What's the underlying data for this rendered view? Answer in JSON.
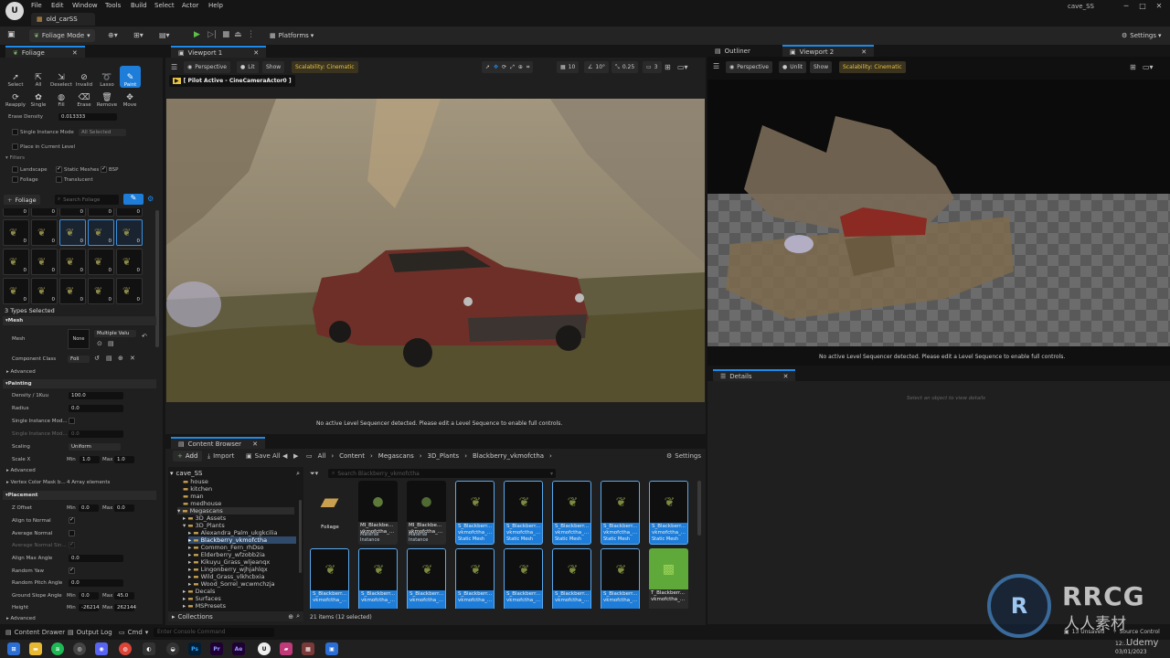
{
  "app": {
    "logo": "U",
    "menu": [
      "File",
      "Edit",
      "Window",
      "Tools",
      "Build",
      "Select",
      "Actor",
      "Help"
    ],
    "doc_tab": "old_carSS",
    "project": "cave_SS"
  },
  "toolbar": {
    "mode": "Foliage Mode",
    "platforms": "Platforms",
    "settings": "Settings"
  },
  "foliage_panel": {
    "title": "Foliage",
    "tools_row1": [
      "Select",
      "All",
      "Deselect",
      "Invalid",
      "Lasso",
      "Paint"
    ],
    "tools_row2": [
      "Reapply",
      "Single",
      "Fill",
      "Erase",
      "Remove",
      "Move"
    ],
    "erase_density_label": "Erase Density",
    "erase_density_value": "0.013333",
    "single_instance_label": "Single Instance Mode",
    "single_instance_value": "All Selected",
    "place_in_level_label": "Place in Current Level",
    "filters_label": "Filters",
    "filters": {
      "landscape": "Landscape",
      "static_meshes": "Static Meshes",
      "bsp": "BSP",
      "foliage": "Foliage",
      "translucent": "Translucent"
    },
    "add_foliage": "Foliage",
    "search_placeholder": "Search Foliage",
    "tile_count": "0",
    "types_selected": "3 Types Selected",
    "sections": {
      "mesh": "Mesh",
      "advanced": "Advanced",
      "painting": "Painting",
      "placement": "Placement"
    },
    "mesh_label": "Mesh",
    "mesh_value": "None",
    "mesh_dropdown": "Multiple Valu",
    "component_class_label": "Component Class",
    "component_class_value": "Foli",
    "density_label": "Density / 1Kuu",
    "density_value": "100.0",
    "radius_label": "Radius",
    "radius_value": "0.0",
    "single_mode_label": "Single Instance Mod...",
    "single_mode2_label": "Single Instance Mod...",
    "single_mode2_value": "0.0",
    "scaling_label": "Scaling",
    "scaling_value": "Uniform",
    "scalex_label": "Scale X",
    "min_label": "Min",
    "max_label": "Max",
    "scalex_min": "1.0",
    "scalex_max": "1.0",
    "vertex_color_label": "Vertex Color Mask b...",
    "vertex_color_value": "4 Array elements",
    "z_offset_label": "Z Offset",
    "z_offset_min": "0.0",
    "z_offset_max": "0.0",
    "align_normal_label": "Align to Normal",
    "avoid_normal_label": "Average Normal",
    "avg_normal_single_label": "Average Normal Sin...",
    "align_max_label": "Align Max Angle",
    "align_max_value": "0.0",
    "random_yaw_label": "Random Yaw",
    "random_pitch_label": "Random Pitch Angle",
    "random_pitch_value": "0.0",
    "ground_slope_label": "Ground Slope Angle",
    "ground_slope_min": "0.0",
    "ground_slope_max": "45.0",
    "height_label": "Height",
    "height_min": "-26214",
    "height_max": "262144"
  },
  "viewport1": {
    "tab": "Viewport 1",
    "perspective": "Perspective",
    "lit": "Lit",
    "show": "Show",
    "scalability": "Scalability: Cinematic",
    "pilot": "[ Pilot Active - CineCameraActor0 ]",
    "grid": "10",
    "angle": "10°",
    "scale": "0.25",
    "cam_speed": "3",
    "sequencer_msg": "No active Level Sequencer detected. Please edit a Level Sequence to enable full controls."
  },
  "viewport2": {
    "outliner_tab": "Outliner",
    "tab": "Viewport 2",
    "perspective": "Perspective",
    "unlit": "Unlit",
    "show": "Show",
    "scalability": "Scalability: Cinematic",
    "sequencer_msg": "No active Level Sequencer detected. Please edit a Level Sequence to enable full controls."
  },
  "details": {
    "tab": "Details",
    "hint": "Select an object to view details"
  },
  "content_browser": {
    "tab": "Content Browser",
    "add": "Add",
    "import": "Import",
    "save_all": "Save All",
    "path": [
      "All",
      "Content",
      "Megascans",
      "3D_Plants",
      "Blackberry_vkmofctha"
    ],
    "settings": "Settings",
    "root": "cave_SS",
    "search_placeholder": "Search Blackberry_vkmofctha",
    "tree": [
      "house",
      "kitchen",
      "man",
      "medhouse",
      "Megascans",
      "3D_Assets",
      "3D_Plants",
      "Alexandra_Palm_ukgkcilia",
      "Blackberry_vkmofctha",
      "Common_Fern_rhDso",
      "Elderberry_wfzobb2ia",
      "Kikuyu_Grass_wljeanqx",
      "Lingonberry_wjhjahlqx",
      "Wild_Grass_vlkhcbxia",
      "Wood_Sorrel_wcwmchzja",
      "Decals",
      "Surfaces",
      "MSPresets"
    ],
    "collections": "Collections",
    "assets": [
      {
        "name": "Foliage",
        "type": ""
      },
      {
        "name": "MI_Blackbe...\nvkmofctha_...",
        "type": "Material Instance"
      },
      {
        "name": "MI_Blackbe...\nvkmofctha_...",
        "type": "Material Instance"
      },
      {
        "name": "S_Blackberr...\nvkmofctha_...",
        "type": "Static Mesh"
      },
      {
        "name": "S_Blackberr...\nvkmofctha_...",
        "type": "Static Mesh"
      },
      {
        "name": "S_Blackberr...\nvkmofctha_...",
        "type": "Static Mesh"
      },
      {
        "name": "S_Blackberr...\nvkmofctha_...",
        "type": "Static Mesh"
      },
      {
        "name": "S_Blackberr...\nvkmofctha_...",
        "type": "Static Mesh"
      },
      {
        "name": "S_Blackberr...\nvkmofctha_...",
        "type": ""
      },
      {
        "name": "S_Blackberr...\nvkmofctha_...",
        "type": ""
      },
      {
        "name": "S_Blackberr...\nvkmofctha_...",
        "type": ""
      },
      {
        "name": "S_Blackberr...\nvkmofctha_...",
        "type": ""
      },
      {
        "name": "S_Blackberr...\nvkmofctha_...",
        "type": ""
      },
      {
        "name": "S_Blackberr...\nvkmofctha_...",
        "type": ""
      },
      {
        "name": "S_Blackberr...\nvkmofctha_...",
        "type": ""
      },
      {
        "name": "T_Blackberr...\nvkmofctha_...",
        "type": ""
      }
    ],
    "count": "21 items (12 selected)"
  },
  "statusbar": {
    "content_drawer": "Content Drawer",
    "output_log": "Output Log",
    "cmd": "Cmd",
    "console_placeholder": "Enter Console Command",
    "unsaved": "13 Unsaved",
    "source_control": "Source Control"
  },
  "taskbar": {
    "clock": "12:...",
    "date": "03/01/2023"
  },
  "watermark": {
    "brand": "RRCG",
    "sub": "人人素材",
    "udemy": "Udemy"
  }
}
